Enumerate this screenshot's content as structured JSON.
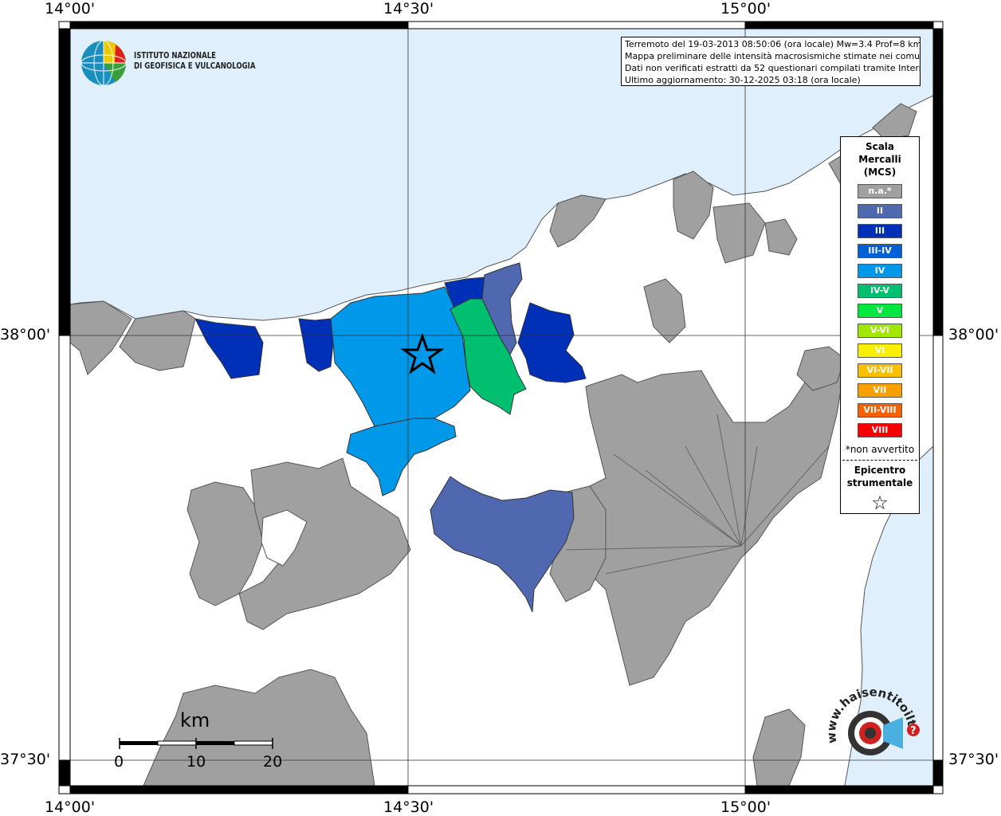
{
  "coordinates": {
    "top": [
      "14°00'",
      "14°30'",
      "15°00'"
    ],
    "bottom": [
      "14°00'",
      "14°30'",
      "15°00'"
    ],
    "left": [
      "38°00'",
      "37°30'"
    ],
    "right": [
      "38°00'",
      "37°30'"
    ]
  },
  "info": {
    "line1": "Terremoto del 19-03-2013 08:50:06 (ora locale) Mw=3.4 Prof=8 km",
    "line2": "Mappa preliminare delle intensità macrosismiche stimate nei comuni",
    "line3": "Dati non verificati estratti da 52 questionari compilati tramite Internet.",
    "line4": "Ultimo aggiornamento: 30-12-2025 03:18 (ora locale)"
  },
  "logo": {
    "line1": "ISTITUTO NAZIONALE",
    "line2": "DI GEOFISICA E VULCANOLOGIA"
  },
  "legend": {
    "title1": "Scala",
    "title2": "Mercalli",
    "title3": "(MCS)",
    "items": [
      {
        "label": "n.a.*",
        "color": "#a0a0a0"
      },
      {
        "label": "II",
        "color": "#5068b0"
      },
      {
        "label": "III",
        "color": "#0030b8"
      },
      {
        "label": "III-IV",
        "color": "#0060d8"
      },
      {
        "label": "IV",
        "color": "#0098e8"
      },
      {
        "label": "IV-V",
        "color": "#00c070"
      },
      {
        "label": "V",
        "color": "#00e840"
      },
      {
        "label": "V-VI",
        "color": "#a0e800"
      },
      {
        "label": "VI",
        "color": "#f8f000"
      },
      {
        "label": "VI-VII",
        "color": "#f8c000"
      },
      {
        "label": "VII",
        "color": "#f8a000"
      },
      {
        "label": "VII-VIII",
        "color": "#f86000"
      },
      {
        "label": "VIII",
        "color": "#f80000"
      }
    ],
    "note": "*non avvertito",
    "epi1": "Epicentro",
    "epi2": "strumentale",
    "star": "☆"
  },
  "scalebar": {
    "title": "km",
    "labels": [
      "0",
      "10",
      "20"
    ]
  },
  "watermark": {
    "text": "www.haisentitoilterremoto.it",
    "question": "?"
  },
  "colors": {
    "sea": "#dff0fc",
    "land": "#ffffff",
    "na": "#a0a0a0",
    "II": "#5068b0",
    "III": "#0030b8",
    "IV": "#0098e8",
    "IV-V": "#00c070"
  }
}
